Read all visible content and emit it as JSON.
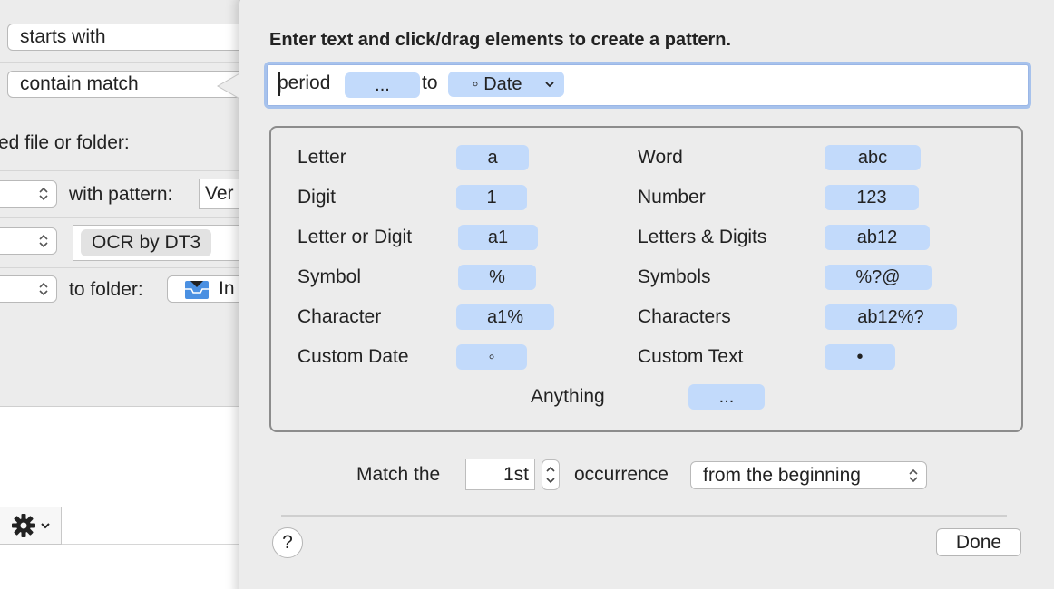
{
  "background": {
    "condition_1": "starts with",
    "condition_2": "contain match",
    "section_label": "ed file or folder:",
    "with_pattern_label": "with pattern:",
    "pattern_value": "Ver",
    "script_token": "OCR by DT3",
    "to_folder_label": "to folder:",
    "folder_name": "In"
  },
  "popover": {
    "instruction": "Enter text and click/drag elements to create a pattern.",
    "pattern": {
      "text_1": "period",
      "chip_1": "...",
      "text_2": "to",
      "chip_2": "◦ Date",
      "chip_2_menu_icon": "chevron-down-icon"
    },
    "elements": {
      "left": [
        {
          "label": "Letter",
          "token": "a"
        },
        {
          "label": "Digit",
          "token": "1"
        },
        {
          "label": "Letter or Digit",
          "token": "a1"
        },
        {
          "label": "Symbol",
          "token": "%"
        },
        {
          "label": "Character",
          "token": "a1%"
        },
        {
          "label": "Custom Date",
          "token": "◦"
        }
      ],
      "right": [
        {
          "label": "Word",
          "token": "abc"
        },
        {
          "label": "Number",
          "token": "123"
        },
        {
          "label": "Letters & Digits",
          "token": "ab12"
        },
        {
          "label": "Symbols",
          "token": "%?@"
        },
        {
          "label": "Characters",
          "token": "ab12%?"
        },
        {
          "label": "Custom Text",
          "token": "•"
        }
      ],
      "anything": {
        "label": "Anything",
        "token": "..."
      }
    },
    "match": {
      "prefix": "Match the",
      "occurrence_value": "1st",
      "occurrence_label": "occurrence",
      "from_option": "from the beginning"
    },
    "help_label": "?",
    "done_label": "Done"
  },
  "colors": {
    "chip_blue": "#c2dafb",
    "focus_ring": "#70a0ec"
  }
}
